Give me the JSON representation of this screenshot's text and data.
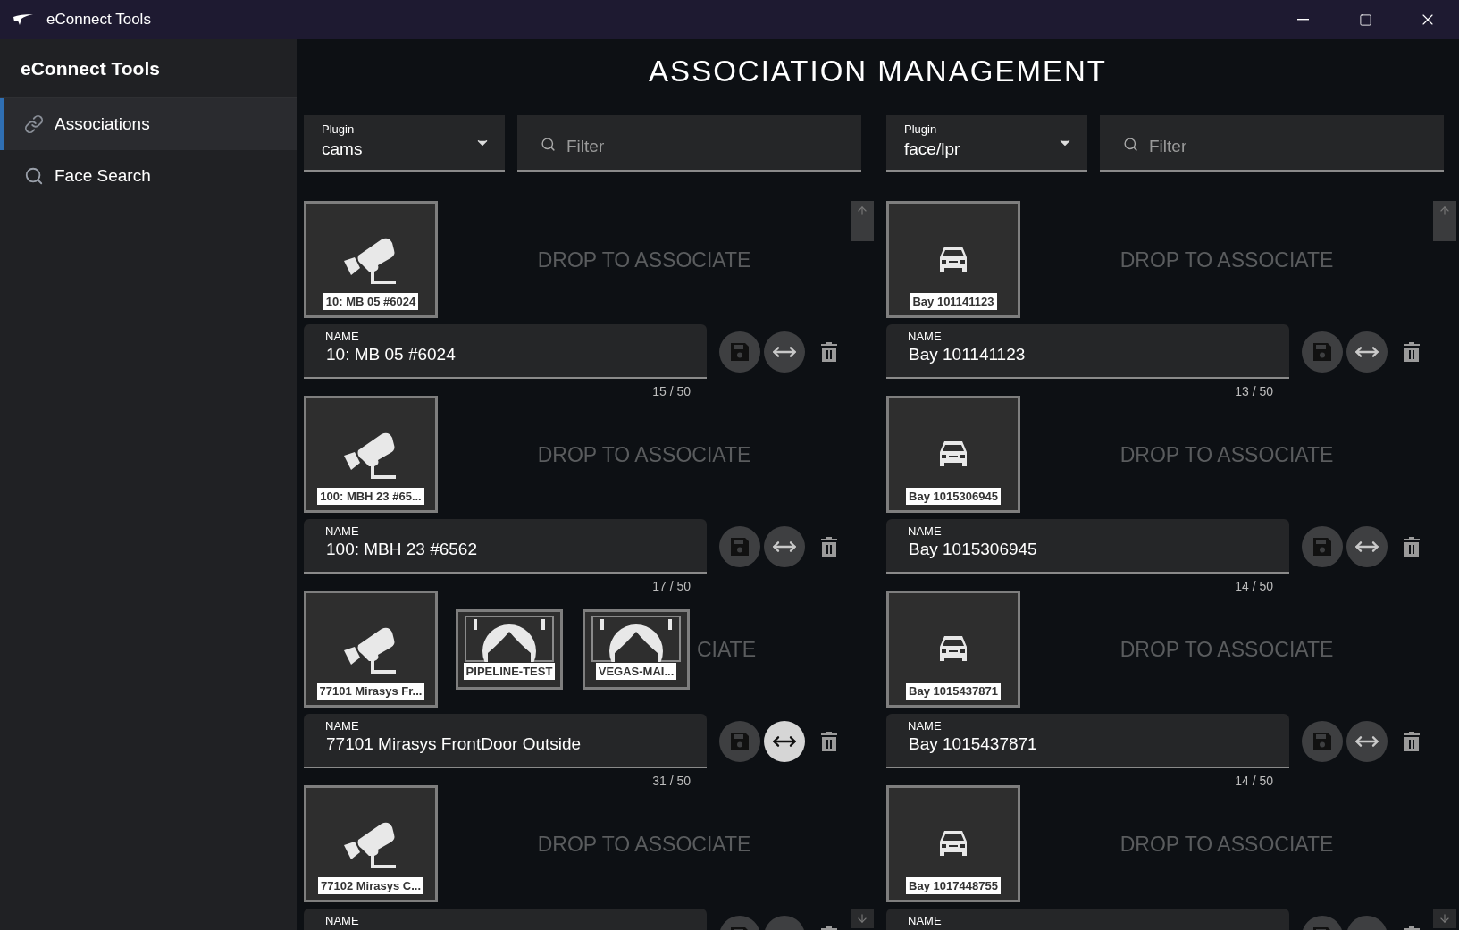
{
  "window": {
    "title": "eConnect Tools"
  },
  "sidebar": {
    "title": "eConnect Tools",
    "items": [
      {
        "label": "Associations",
        "selected": true
      },
      {
        "label": "Face Search",
        "selected": false
      }
    ]
  },
  "page_title": "ASSOCIATION MANAGEMENT",
  "panels": [
    {
      "plugin": {
        "label": "Plugin",
        "value": "cams"
      },
      "filter": {
        "placeholder": "Filter"
      },
      "entries": [
        {
          "tile": {
            "kind": "camera",
            "label": "10: MB 05 #6024"
          },
          "drop_text": "DROP TO ASSOCIATE",
          "name_label": "NAME",
          "name": "10: MB 05 #6024",
          "counter": "15 / 50",
          "swap_active": false
        },
        {
          "tile": {
            "kind": "camera",
            "label": "100: MBH 23 #65..."
          },
          "drop_text": "DROP TO ASSOCIATE",
          "name_label": "NAME",
          "name": "100: MBH 23 #6562",
          "counter": "17 / 50",
          "swap_active": false
        },
        {
          "tile": {
            "kind": "camera",
            "label": "77101 Mirasys Fr..."
          },
          "associated": [
            {
              "kind": "person",
              "label": "PIPELINE-TEST"
            },
            {
              "kind": "person",
              "label": "VEGAS-MAI..."
            }
          ],
          "drop_text": "CIATE",
          "drop_text_covered": true,
          "name_label": "NAME",
          "name": "77101 Mirasys FrontDoor Outside",
          "counter": "31 / 50",
          "swap_active": true
        },
        {
          "tile": {
            "kind": "camera",
            "label": "77102 Mirasys C..."
          },
          "drop_text": "DROP TO ASSOCIATE",
          "name_label": "NAME"
        }
      ]
    },
    {
      "plugin": {
        "label": "Plugin",
        "value": "face/lpr"
      },
      "filter": {
        "placeholder": "Filter"
      },
      "entries": [
        {
          "tile": {
            "kind": "car",
            "label": "Bay 101141123"
          },
          "drop_text": "DROP TO ASSOCIATE",
          "name_label": "NAME",
          "name": "Bay 101141123",
          "counter": "13 / 50",
          "swap_active": false
        },
        {
          "tile": {
            "kind": "car",
            "label": "Bay 1015306945"
          },
          "drop_text": "DROP TO ASSOCIATE",
          "name_label": "NAME",
          "name": "Bay 1015306945",
          "counter": "14 / 50",
          "swap_active": false
        },
        {
          "tile": {
            "kind": "car",
            "label": "Bay 1015437871"
          },
          "drop_text": "DROP TO ASSOCIATE",
          "name_label": "NAME",
          "name": "Bay 1015437871",
          "counter": "14 / 50",
          "swap_active": false
        },
        {
          "tile": {
            "kind": "car",
            "label": "Bay 1017448755"
          },
          "drop_text": "DROP TO ASSOCIATE",
          "name_label": "NAME"
        }
      ]
    }
  ]
}
